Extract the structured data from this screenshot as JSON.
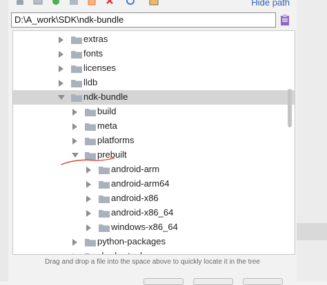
{
  "toolbar": {
    "hide_path_label": "Hide path",
    "icons": [
      "home-icon",
      "desktop-icon",
      "project-icon",
      "new-folder-icon",
      "delete-icon",
      "refresh-icon",
      "show-hidden-icon"
    ]
  },
  "path": {
    "value": "D:\\A_work\\SDK\\ndk-bundle"
  },
  "tree": {
    "items": [
      {
        "label": "extras",
        "expanded": false,
        "selected": false
      },
      {
        "label": "fonts",
        "expanded": false,
        "selected": false
      },
      {
        "label": "licenses",
        "expanded": false,
        "selected": false
      },
      {
        "label": "lldb",
        "expanded": false,
        "selected": false
      },
      {
        "label": "ndk-bundle",
        "expanded": true,
        "selected": true
      },
      {
        "label": "build",
        "expanded": false,
        "selected": false
      },
      {
        "label": "meta",
        "expanded": false,
        "selected": false
      },
      {
        "label": "platforms",
        "expanded": false,
        "selected": false
      },
      {
        "label": "prebuilt",
        "expanded": true,
        "selected": false
      },
      {
        "label": "android-arm",
        "expanded": false,
        "selected": false
      },
      {
        "label": "android-arm64",
        "expanded": false,
        "selected": false
      },
      {
        "label": "android-x86",
        "expanded": false,
        "selected": false
      },
      {
        "label": "android-x86_64",
        "expanded": false,
        "selected": false
      },
      {
        "label": "windows-x86_64",
        "expanded": false,
        "selected": false
      },
      {
        "label": "python-packages",
        "expanded": false,
        "selected": false
      },
      {
        "label": "shader-tools",
        "expanded": false,
        "selected": false
      }
    ]
  },
  "hint": "Drag and drop a file into the space above to quickly locate it in the tree",
  "colors": {
    "folder": "#a9b1bc",
    "selection": "#d5d5d5",
    "link": "#2f5fb3",
    "annotation": "#e0443a"
  }
}
